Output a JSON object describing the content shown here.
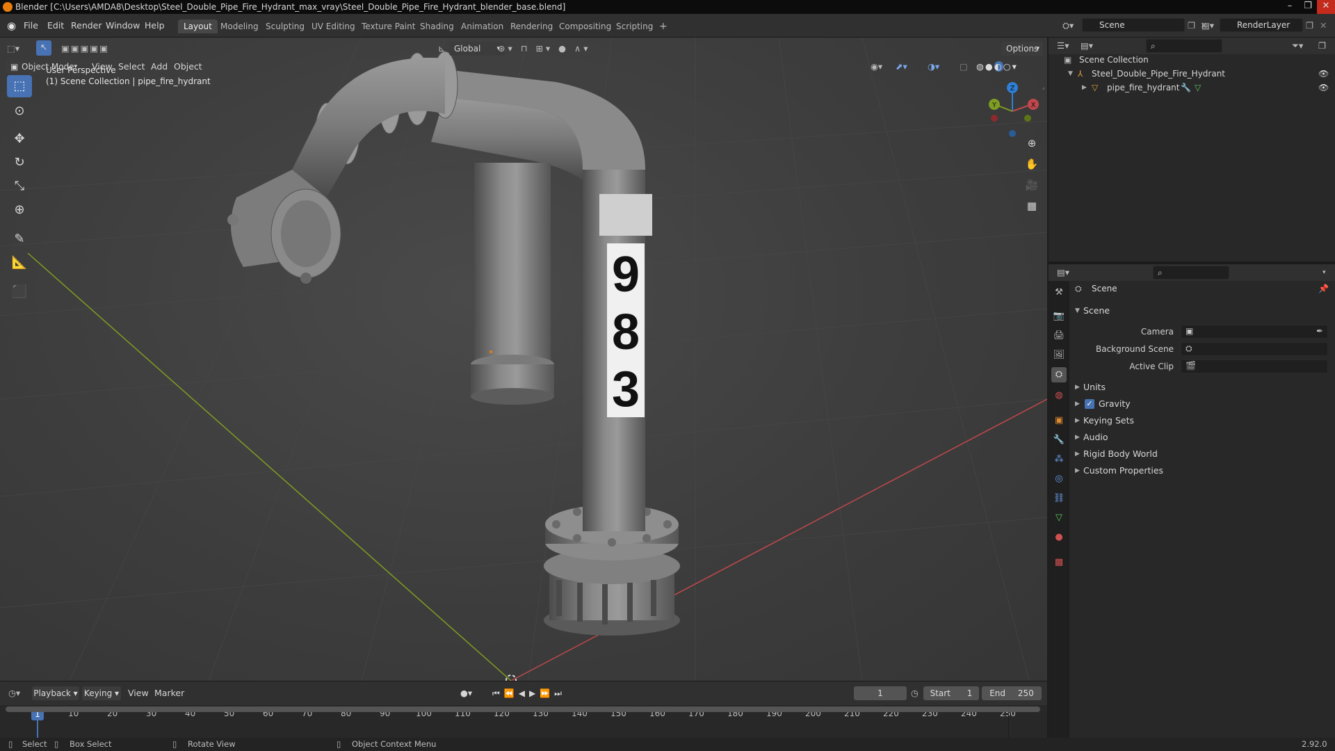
{
  "window": {
    "title": "Blender [C:\\Users\\AMDA8\\Desktop\\Steel_Double_Pipe_Fire_Hydrant_max_vray\\Steel_Double_Pipe_Fire_Hydrant_blender_base.blend]",
    "controls": [
      "–",
      "❐",
      "✕"
    ]
  },
  "menubar": {
    "items": [
      "File",
      "Edit",
      "Render",
      "Window",
      "Help"
    ],
    "workspaces": [
      "Layout",
      "Modeling",
      "Sculpting",
      "UV Editing",
      "Texture Paint",
      "Shading",
      "Animation",
      "Rendering",
      "Compositing",
      "Scripting"
    ],
    "active_workspace": "Layout",
    "add_workspace": "+",
    "scene_label": "Scene",
    "view_layer_label": "RenderLayer"
  },
  "viewport": {
    "mode": "Object Mode",
    "menus": [
      "View",
      "Select",
      "Add",
      "Object"
    ],
    "transform_orientation": "Global",
    "options_label": "Options",
    "overlay_line1": "User Perspective",
    "overlay_line2": "(1) Scene Collection | pipe_fire_hydrant",
    "gizmo_axes": [
      "X",
      "Y",
      "Z"
    ],
    "hydrant_number": [
      "9",
      "8",
      "3"
    ],
    "colors": {
      "x_axis": "#c0484c",
      "y_axis": "#7f9d22",
      "z_axis": "#2f7fd6",
      "selected_tool": "#4772b3"
    }
  },
  "timeline": {
    "menus": [
      "Playback",
      "Keying",
      "View",
      "Marker"
    ],
    "current_frame": "1",
    "start_label": "Start",
    "start_value": "1",
    "end_label": "End",
    "end_value": "250",
    "ticks": [
      "10",
      "20",
      "30",
      "40",
      "50",
      "60",
      "70",
      "80",
      "90",
      "100",
      "110",
      "120",
      "130",
      "140",
      "150",
      "160",
      "170",
      "180",
      "190",
      "200",
      "210",
      "220",
      "230",
      "240",
      "250"
    ],
    "playhead": "1"
  },
  "statusbar": {
    "select": "Select",
    "box_select": "Box Select",
    "rotate_view": "Rotate View",
    "context_menu": "Object Context Menu",
    "version": "2.92.0"
  },
  "outliner": {
    "root": "Scene Collection",
    "collection": "Steel_Double_Pipe_Fire_Hydrant",
    "object": "pipe_fire_hydrant"
  },
  "properties": {
    "context": "Scene",
    "panel": "Scene",
    "camera_label": "Camera",
    "background_scene_label": "Background Scene",
    "active_clip_label": "Active Clip",
    "subpanels": [
      "Units",
      "Gravity",
      "Keying Sets",
      "Audio",
      "Rigid Body World",
      "Custom Properties"
    ],
    "gravity_checked": true
  }
}
